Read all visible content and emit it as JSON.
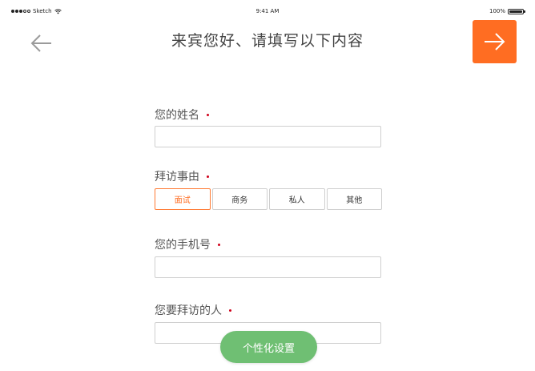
{
  "status_bar": {
    "carrier": "Sketch",
    "time": "9:41 AM",
    "battery": "100%"
  },
  "header": {
    "title": "来宾您好、请填写以下内容",
    "back_icon": "arrow-left-icon",
    "next_icon": "arrow-right-icon"
  },
  "form": {
    "name_label": "您的姓名",
    "reason_label": "拜访事由",
    "reason_options": [
      "面试",
      "商务",
      "私人",
      "其他"
    ],
    "reason_selected": "面试",
    "phone_label": "您的手机号",
    "host_label": "您要拜访的人"
  },
  "actions": {
    "personalize_label": "个性化设置"
  },
  "colors": {
    "accent": "#ff6d22",
    "required": "#d0021b",
    "floating_button": "#6fbf73"
  }
}
